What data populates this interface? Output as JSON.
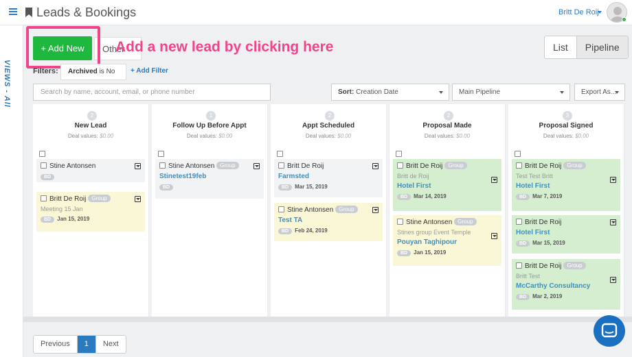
{
  "header": {
    "title": "Leads & Bookings",
    "user_name": "Britt De Roij"
  },
  "rail": {
    "views_label": "VIEWS - All"
  },
  "toolbar": {
    "add_new_label": "+ Add New",
    "other_label": "Other",
    "annotation": "Add a new lead by clicking here",
    "view_list": "List",
    "view_pipeline": "Pipeline",
    "filters_label": "Filters:",
    "filter_chip_field": "Archived",
    "filter_chip_rest": " is No",
    "add_filter": "+ Add Filter",
    "search_placeholder": "Search by name, account, email, or phone number",
    "sort_label": "Sort:",
    "sort_value": " Creation Date",
    "pipeline_value": "Main Pipeline",
    "export_label": "Export As..."
  },
  "columns": [
    {
      "count": "2",
      "title": "New Lead",
      "deal_label": "Deal values:",
      "deal_value": "$0.00",
      "cards": [
        {
          "name": "Stine Antonsen",
          "group": "",
          "sub": "",
          "link": "",
          "initials": "BD",
          "date": ""
        },
        {
          "name": "Britt De Roij",
          "group": "Group",
          "sub": "Meeting 15 Jan",
          "link": "",
          "initials": "BD",
          "date": "Jan 15, 2019"
        }
      ]
    },
    {
      "count": "1",
      "title": "Follow Up Before Appt",
      "deal_label": "Deal values:",
      "deal_value": "$0.00",
      "cards": [
        {
          "name": "Stine Antonsen",
          "group": "Group",
          "sub": "",
          "link": "Stinetest19feb",
          "initials": "BD",
          "date": ""
        }
      ]
    },
    {
      "count": "2",
      "title": "Appt Scheduled",
      "deal_label": "Deal values:",
      "deal_value": "$0.00",
      "cards": [
        {
          "name": "Britt De Roij",
          "group": "",
          "sub": "",
          "link": "Farmsted",
          "initials": "BD",
          "date": "Mar 15, 2019"
        },
        {
          "name": "Stine Antonsen",
          "group": "Group",
          "sub": "",
          "link": "Test TA",
          "initials": "BD",
          "date": "Feb 24, 2019"
        }
      ]
    },
    {
      "count": "2",
      "title": "Proposal Made",
      "deal_label": "Deal values:",
      "deal_value": "$0.00",
      "cards": [
        {
          "name": "Britt De Roij",
          "group": "Group",
          "sub": "Britt de Roij",
          "link": "Hotel First",
          "initials": "BD",
          "date": "Mar 14, 2019"
        },
        {
          "name": "Stine Antonsen",
          "group": "Group",
          "sub": "Stines group Event Temple",
          "link": "Pouyan Taghipour",
          "initials": "BD",
          "date": "Jan 15, 2019"
        }
      ]
    },
    {
      "count": "3",
      "title": "Proposal Signed",
      "deal_label": "Deal values:",
      "deal_value": "$0.00",
      "cards": [
        {
          "name": "Britt De Roij",
          "group": "Group",
          "sub": "Test Test Britt",
          "link": "Hotel First",
          "initials": "BD",
          "date": "Mar 7, 2019"
        },
        {
          "name": "Britt De Roij",
          "group": "",
          "sub": "",
          "link": "Hotel First",
          "initials": "BD",
          "date": "Mar 15, 2019"
        },
        {
          "name": "Britt De Roij",
          "group": "Group",
          "sub": "Britt Test",
          "link": "McCarthy Consultancy",
          "initials": "BD",
          "date": "Mar 2, 2019"
        }
      ]
    }
  ],
  "pager": {
    "previous": "Previous",
    "current": "1",
    "next": "Next"
  },
  "colors": {
    "accent": "#2a7ac0",
    "add_new": "#1fb83e",
    "annotation": "#f0458a"
  }
}
